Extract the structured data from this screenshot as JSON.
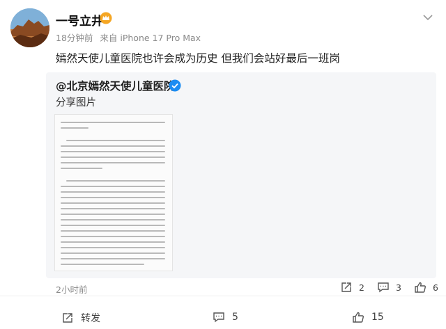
{
  "author": {
    "name": "一号立井",
    "badge_icon": "vip-crown-icon"
  },
  "meta": {
    "time": "18分钟前",
    "source": "来自 iPhone 17 Pro Max"
  },
  "post": {
    "text": "嫣然天使儿童医院也许会成为历史 但我们会站好最后一班岗"
  },
  "repost": {
    "mention": "@北京嫣然天使儿童医院",
    "verified_icon": "verified-badge-icon",
    "subtitle": "分享图片",
    "time": "2小时前",
    "repost_count": "2",
    "comment_count": "3",
    "like_count": "6"
  },
  "footer": {
    "repost_label": "转发",
    "comment_count": "5",
    "like_count": "15"
  },
  "colors": {
    "badge_yellow": "#f5a623",
    "verified_blue": "#1b8cf2",
    "meta_gray": "#8a8a8a",
    "card_bg": "#f5f6f8"
  }
}
